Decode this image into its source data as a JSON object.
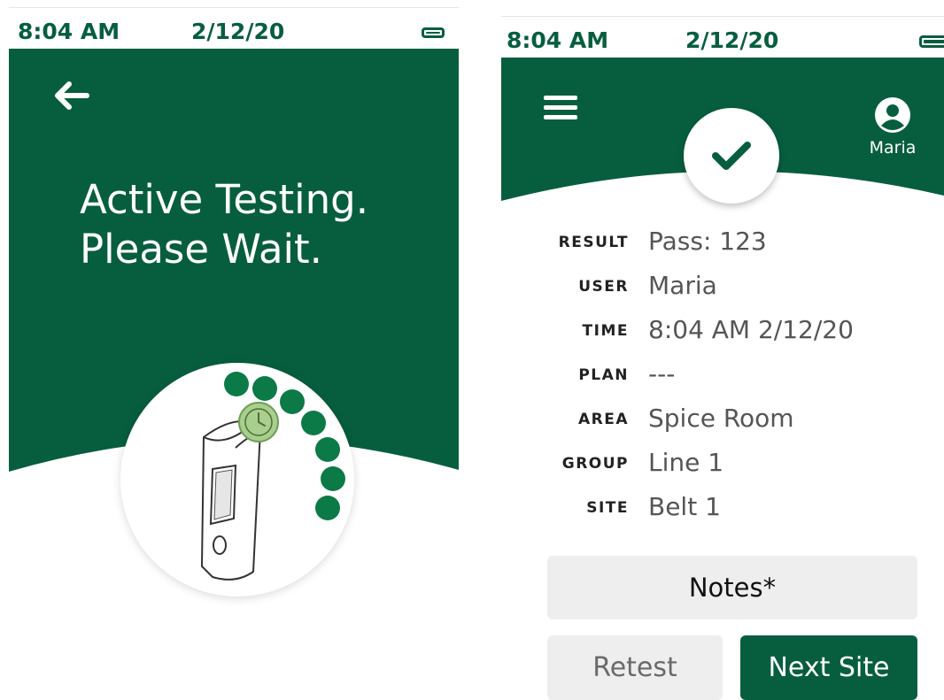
{
  "colors": {
    "brand_green": "#075e3f",
    "accent_dot_green": "#0b7a47",
    "clock_badge_green": "#a9cf8c"
  },
  "left_screen": {
    "status": {
      "time": "8:04 AM",
      "date": "2/12/20"
    },
    "title_line1": "Active Testing.",
    "title_line2": "Please Wait."
  },
  "right_screen": {
    "status": {
      "time": "8:04 AM",
      "date": "2/12/20"
    },
    "user_name": "Maria",
    "details": [
      {
        "label": "RESULT",
        "value": "Pass: 123"
      },
      {
        "label": "USER",
        "value": "Maria"
      },
      {
        "label": "TIME",
        "value": "8:04 AM 2/12/20"
      },
      {
        "label": "PLAN",
        "value": "---"
      },
      {
        "label": "AREA",
        "value": "Spice Room"
      },
      {
        "label": "GROUP",
        "value": "Line 1"
      },
      {
        "label": "SITE",
        "value": "Belt 1"
      }
    ],
    "notes_label": "Notes*",
    "retest_label": "Retest",
    "next_site_label": "Next Site"
  }
}
